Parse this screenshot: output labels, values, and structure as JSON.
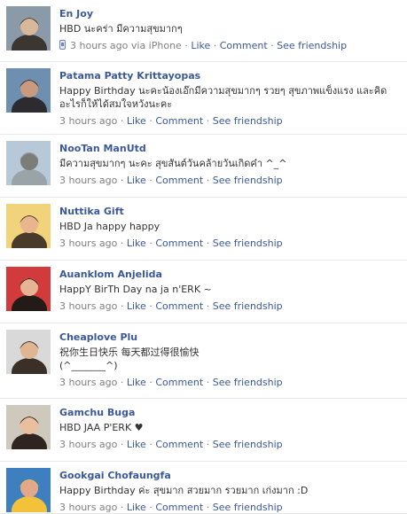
{
  "posts": [
    {
      "name": "En Joy",
      "message": "HBD นะคร่า มีความสุขมากๆ",
      "time": "3 hours ago",
      "via": "via iPhone",
      "show_phone_icon": true,
      "avatar": "avatar-icon"
    },
    {
      "name": "Patama Patty Krittayopas",
      "message": "Happy Birthday นะคะน้องเอ๊กมีความสุขมากๆ รวยๆ สุขภาพแข็งแรง และคิดอะไรก็ให้ได้สมใจหวังนะคะ",
      "time": "3 hours ago",
      "via": "",
      "show_phone_icon": false,
      "avatar": "avatar-icon"
    },
    {
      "name": "NooTan ManUtd",
      "message": "มีความสุขมากๆ นะคะ สุขสันต์วันคล้ายวันเกิดค๋า ^_^",
      "time": "3 hours ago",
      "via": "",
      "show_phone_icon": false,
      "avatar": "avatar-icon"
    },
    {
      "name": "Nuttika Gift",
      "message": "HBD Ja happy happy",
      "time": "3 hours ago",
      "via": "",
      "show_phone_icon": false,
      "avatar": "avatar-icon"
    },
    {
      "name": "Auanklom Anjelida",
      "message": "HappY BirTh Day na ja n'ERK ~",
      "time": "3 hours ago",
      "via": "",
      "show_phone_icon": false,
      "avatar": "avatar-icon"
    },
    {
      "name": "Cheaplove Plu",
      "message": "祝你生日快乐 每天都过得很愉快\n(^_______^)",
      "time": "3 hours ago",
      "via": "",
      "show_phone_icon": false,
      "avatar": "avatar-icon"
    },
    {
      "name": "Gamchu Buga",
      "message": "HBD JAA P'ERK ♥",
      "time": "3 hours ago",
      "via": "",
      "show_phone_icon": false,
      "avatar": "avatar-icon"
    },
    {
      "name": "Gookgai Chofaungfa",
      "message": "Happy Birthday ค่ะ สุขมาก สวยมาก รวยมาก เก่งมาก :D",
      "time": "3 hours ago",
      "via": "",
      "show_phone_icon": false,
      "avatar": "avatar-icon"
    }
  ],
  "actions": {
    "like": "Like",
    "comment": "Comment",
    "see_friendship": "See friendship",
    "separator": "·"
  },
  "colors": {
    "link": "#3b5998",
    "meta": "#808080",
    "text": "#333333",
    "divider": "#e9e9e9"
  }
}
